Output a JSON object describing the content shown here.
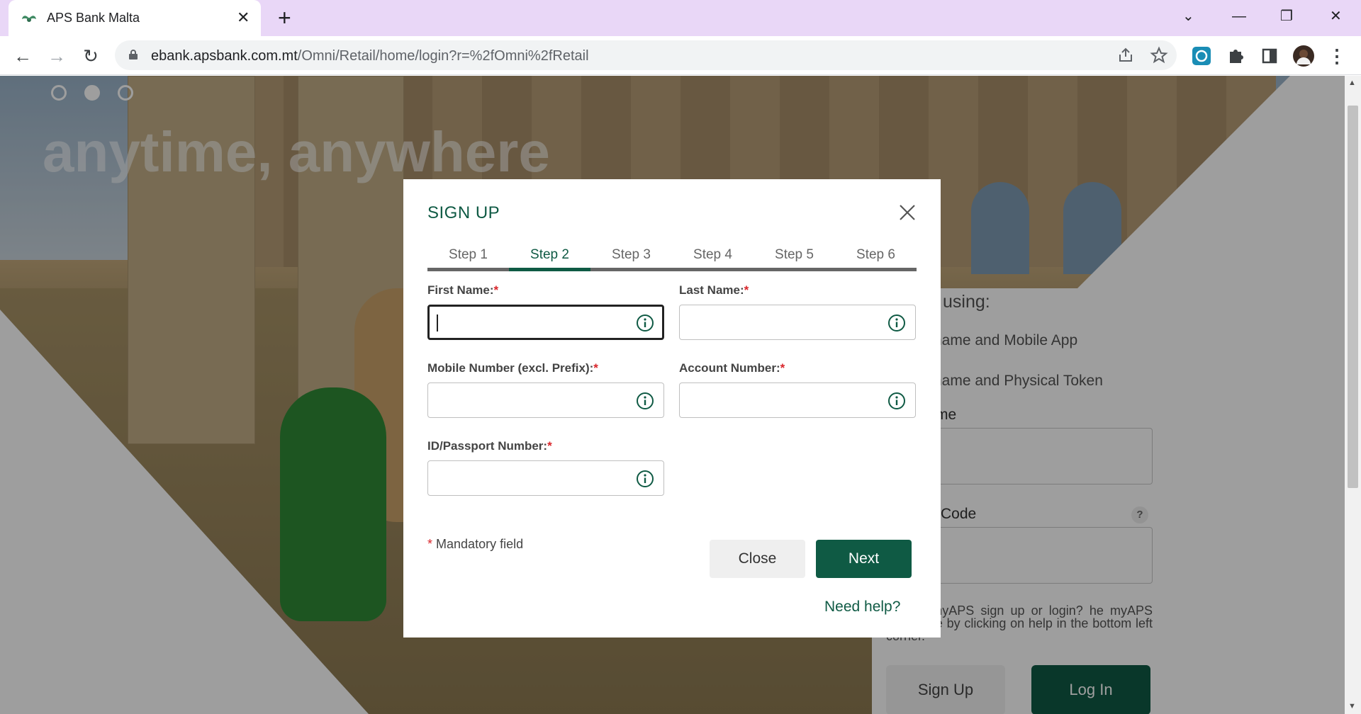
{
  "browser": {
    "tab_title": "APS Bank Malta",
    "url_host": "ebank.apsbank.com.mt",
    "url_path": "/Omni/Retail/home/login?r=%2fOmni%2fRetail"
  },
  "page": {
    "hero_heading": "anytime, anywhere",
    "login_title": "using:",
    "login_option_1": "rname and Mobile App",
    "login_option_2": "rname and Physical Token",
    "username_label": "me",
    "code_label": "Code",
    "code_help": "?",
    "help_text": "lp with myAPS sign up or login? he myAPS help page by clicking on help in the bottom left corner.",
    "signup_button": "Sign Up",
    "login_button": "Log In"
  },
  "modal": {
    "title": "SIGN UP",
    "steps": [
      "Step 1",
      "Step 2",
      "Step 3",
      "Step 4",
      "Step 5",
      "Step 6"
    ],
    "active_step": 2,
    "fields": {
      "first_name": {
        "label": "First Name:",
        "value": ""
      },
      "last_name": {
        "label": "Last Name:",
        "value": ""
      },
      "mobile": {
        "label": "Mobile Number (excl. Prefix):",
        "value": ""
      },
      "account": {
        "label": "Account Number:",
        "value": ""
      },
      "id_passport": {
        "label": "ID/Passport Number:",
        "value": ""
      }
    },
    "required_mark": "*",
    "mandatory_note": "Mandatory field",
    "close_button": "Close",
    "next_button": "Next",
    "need_help": "Need help?"
  },
  "colors": {
    "brand_green": "#0f5a44",
    "required_red": "#d9262b"
  }
}
